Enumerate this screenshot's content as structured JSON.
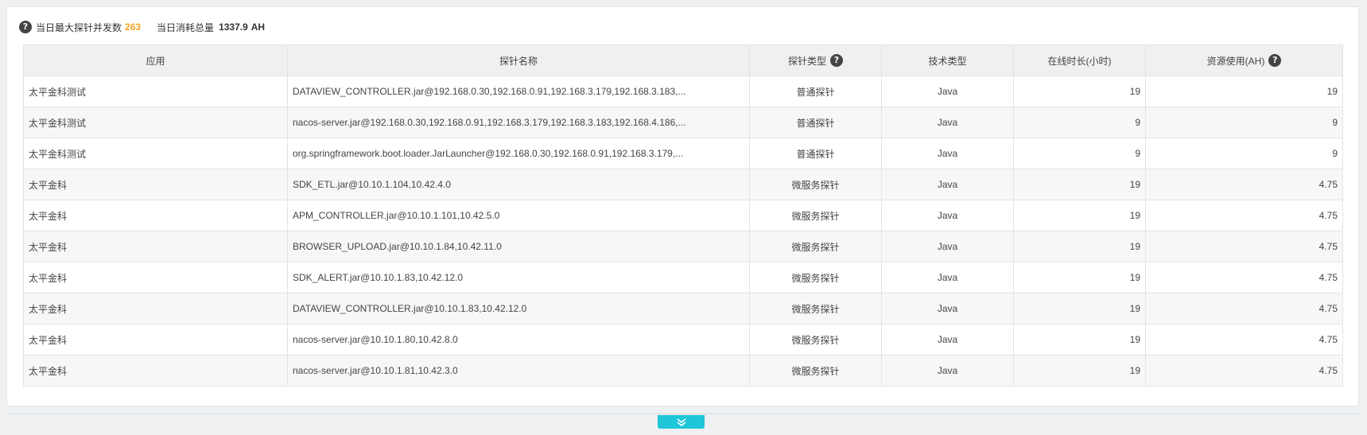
{
  "stats": {
    "max_concurrent_label": "当日最大探针并发数",
    "max_concurrent_value": "263",
    "total_consumption_label": "当日消耗总量",
    "total_consumption_value": "1337.9",
    "total_consumption_unit": "AH",
    "accent_color": "#f5a623"
  },
  "table": {
    "headers": {
      "app": "应用",
      "probe_name": "探针名称",
      "probe_type": "探针类型",
      "tech_type": "技术类型",
      "online_hours": "在线时长(小时)",
      "resource_usage": "资源使用(AH)"
    },
    "rows": [
      {
        "app": "太平金科测试",
        "probe_name": "DATAVIEW_CONTROLLER.jar@192.168.0.30,192.168.0.91,192.168.3.179,192.168.3.183,...",
        "probe_type": "普通探针",
        "tech_type": "Java",
        "online_hours": "19",
        "resource_usage": "19"
      },
      {
        "app": "太平金科测试",
        "probe_name": "nacos-server.jar@192.168.0.30,192.168.0.91,192.168.3.179,192.168.3.183,192.168.4.186,...",
        "probe_type": "普通探针",
        "tech_type": "Java",
        "online_hours": "9",
        "resource_usage": "9"
      },
      {
        "app": "太平金科测试",
        "probe_name": "org.springframework.boot.loader.JarLauncher@192.168.0.30,192.168.0.91,192.168.3.179,...",
        "probe_type": "普通探针",
        "tech_type": "Java",
        "online_hours": "9",
        "resource_usage": "9"
      },
      {
        "app": "太平金科",
        "probe_name": "SDK_ETL.jar@10.10.1.104,10.42.4.0",
        "probe_type": "微服务探针",
        "tech_type": "Java",
        "online_hours": "19",
        "resource_usage": "4.75"
      },
      {
        "app": "太平金科",
        "probe_name": "APM_CONTROLLER.jar@10.10.1.101,10.42.5.0",
        "probe_type": "微服务探针",
        "tech_type": "Java",
        "online_hours": "19",
        "resource_usage": "4.75"
      },
      {
        "app": "太平金科",
        "probe_name": "BROWSER_UPLOAD.jar@10.10.1.84,10.42.11.0",
        "probe_type": "微服务探针",
        "tech_type": "Java",
        "online_hours": "19",
        "resource_usage": "4.75"
      },
      {
        "app": "太平金科",
        "probe_name": "SDK_ALERT.jar@10.10.1.83,10.42.12.0",
        "probe_type": "微服务探针",
        "tech_type": "Java",
        "online_hours": "19",
        "resource_usage": "4.75"
      },
      {
        "app": "太平金科",
        "probe_name": "DATAVIEW_CONTROLLER.jar@10.10.1.83,10.42.12.0",
        "probe_type": "微服务探针",
        "tech_type": "Java",
        "online_hours": "19",
        "resource_usage": "4.75"
      },
      {
        "app": "太平金科",
        "probe_name": "nacos-server.jar@10.10.1.80,10.42.8.0",
        "probe_type": "微服务探针",
        "tech_type": "Java",
        "online_hours": "19",
        "resource_usage": "4.75"
      },
      {
        "app": "太平金科",
        "probe_name": "nacos-server.jar@10.10.1.81,10.42.3.0",
        "probe_type": "微服务探针",
        "tech_type": "Java",
        "online_hours": "19",
        "resource_usage": "4.75"
      }
    ]
  },
  "icons": {
    "help": "question-circle-icon",
    "expand": "double-chevron-down-icon"
  },
  "colors": {
    "expand_button": "#1ec6d8",
    "header_background": "#f0f0f0"
  }
}
